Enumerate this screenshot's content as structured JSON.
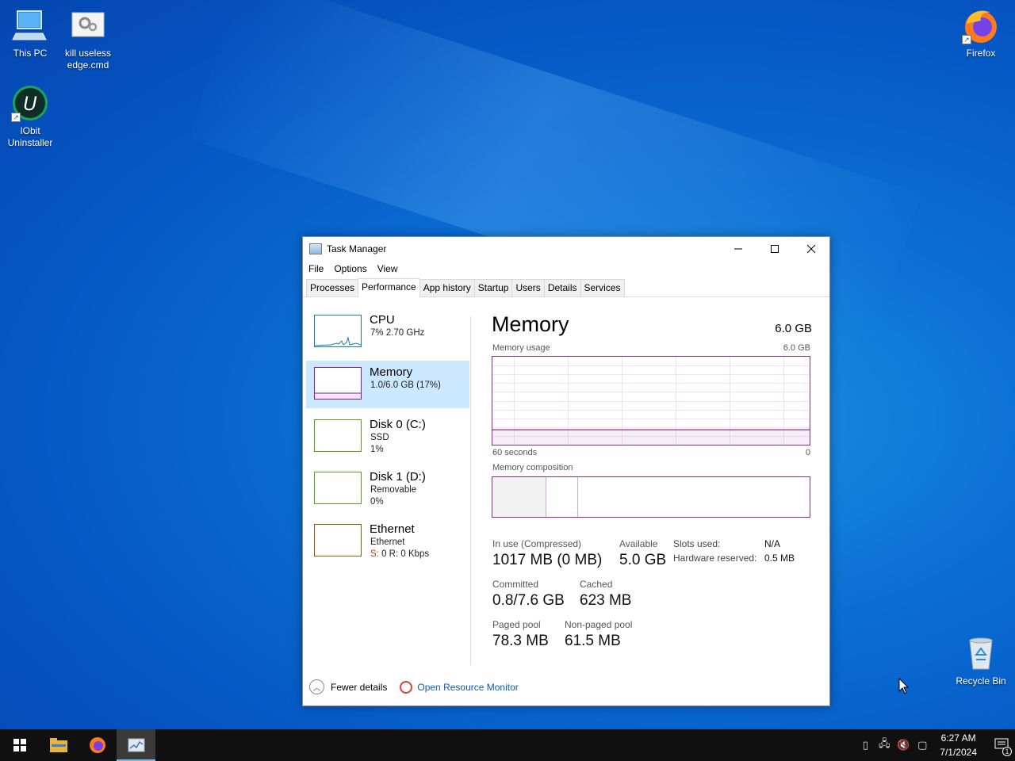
{
  "desktop": {
    "icons": [
      {
        "label": "This PC"
      },
      {
        "label": "kill useless edge.cmd"
      },
      {
        "label": "IObit Uninstaller"
      },
      {
        "label": "Firefox"
      },
      {
        "label": "Recycle Bin"
      }
    ]
  },
  "window": {
    "title": "Task Manager",
    "menu": [
      "File",
      "Options",
      "View"
    ],
    "tabs": [
      "Processes",
      "Performance",
      "App history",
      "Startup",
      "Users",
      "Details",
      "Services"
    ],
    "active_tab": "Performance"
  },
  "sidebar": {
    "items": [
      {
        "name": "CPU",
        "sub1": "7%  2.70 GHz",
        "sub2": "",
        "color": "#117dbb"
      },
      {
        "name": "Memory",
        "sub1": "1.0/6.0 GB (17%)",
        "sub2": "",
        "color": "#8b12ae",
        "selected": true
      },
      {
        "name": "Disk 0 (C:)",
        "sub1": "SSD",
        "sub2": "1%",
        "color": "#4da60c"
      },
      {
        "name": "Disk 1 (D:)",
        "sub1": "Removable",
        "sub2": "0%",
        "color": "#4da60c"
      },
      {
        "name": "Ethernet",
        "sub1": "Ethernet",
        "sub2_prefix": "S:",
        "sub2": "0  R: 0 Kbps",
        "color": "#a74f01"
      }
    ]
  },
  "memory": {
    "title": "Memory",
    "total": "6.0 GB",
    "usage_label": "Memory usage",
    "usage_max": "6.0 GB",
    "axis_left": "60 seconds",
    "axis_right": "0",
    "usage_fraction": 0.17,
    "composition_label": "Memory composition",
    "stats": {
      "in_use_label": "In use (Compressed)",
      "in_use_value": "1017 MB (0 MB)",
      "available_label": "Available",
      "available_value": "5.0 GB",
      "committed_label": "Committed",
      "committed_value": "0.8/7.6 GB",
      "cached_label": "Cached",
      "cached_value": "623 MB",
      "paged_label": "Paged pool",
      "paged_value": "78.3 MB",
      "nonpaged_label": "Non-paged pool",
      "nonpaged_value": "61.5 MB",
      "slots_label": "Slots used:",
      "slots_value": "N/A",
      "hw_label": "Hardware reserved:",
      "hw_value": "0.5 MB"
    }
  },
  "footer": {
    "fewer_details": "Fewer details",
    "resource_monitor": "Open Resource Monitor"
  },
  "taskbar": {
    "time": "6:27 AM",
    "date": "7/1/2024",
    "notification_count": "1"
  },
  "colors": {
    "memory_accent": "#8b2c96",
    "selection": "#cce8ff",
    "taskbar": "#101010"
  }
}
